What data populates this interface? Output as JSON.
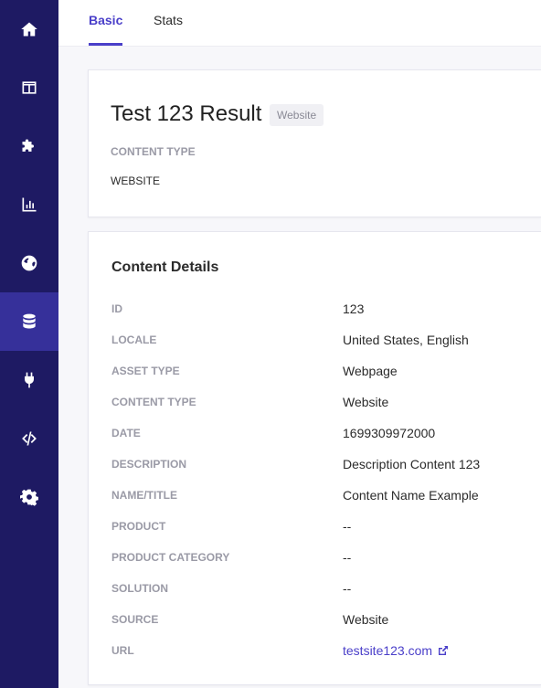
{
  "sidebar": {
    "items": [
      {
        "icon": "home-icon",
        "active": false
      },
      {
        "icon": "table-icon",
        "active": false
      },
      {
        "icon": "puzzle-icon",
        "active": false
      },
      {
        "icon": "bar-chart-icon",
        "active": false
      },
      {
        "icon": "globe-icon",
        "active": false
      },
      {
        "icon": "database-icon",
        "active": true
      },
      {
        "icon": "plug-icon",
        "active": false
      },
      {
        "icon": "code-icon",
        "active": false
      },
      {
        "icon": "gear-icon",
        "active": false
      }
    ],
    "background": "#1e1a63",
    "active_background": "#36309a"
  },
  "tabs": [
    {
      "label": "Basic",
      "active": true
    },
    {
      "label": "Stats",
      "active": false
    }
  ],
  "summary": {
    "title": "Test 123 Result",
    "badge": "Website",
    "content_type_label": "CONTENT TYPE",
    "content_type_value": "WEBSITE"
  },
  "details": {
    "title": "Content Details",
    "rows": [
      {
        "label": "ID",
        "value": "123"
      },
      {
        "label": "LOCALE",
        "value": "United States, English"
      },
      {
        "label": "ASSET TYPE",
        "value": "Webpage"
      },
      {
        "label": "CONTENT TYPE",
        "value": "Website"
      },
      {
        "label": "DATE",
        "value": "1699309972000"
      },
      {
        "label": "DESCRIPTION",
        "value": "Description Content 123"
      },
      {
        "label": "NAME/TITLE",
        "value": "Content Name Example"
      },
      {
        "label": "PRODUCT",
        "value": "--"
      },
      {
        "label": "PRODUCT CATEGORY",
        "value": "--"
      },
      {
        "label": "SOLUTION",
        "value": "--"
      },
      {
        "label": "SOURCE",
        "value": "Website"
      },
      {
        "label": "URL",
        "value": "testsite123.com"
      }
    ]
  },
  "colors": {
    "accent": "#4a3fc9",
    "label": "#9a9aa6"
  }
}
